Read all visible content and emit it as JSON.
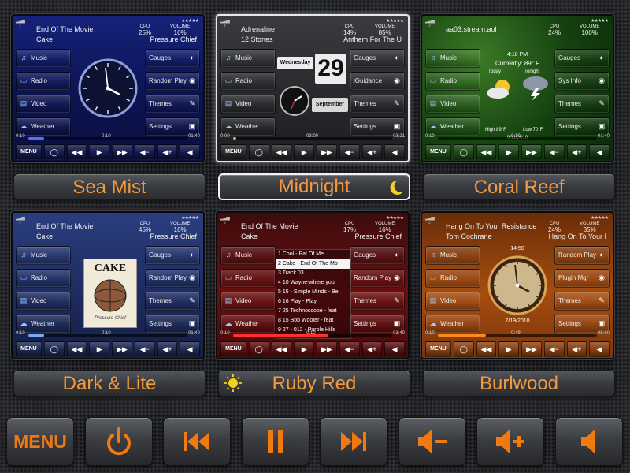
{
  "themes": [
    {
      "name": "Sea Mist",
      "accent": "#5a6dff",
      "line1": "End Of The Movie",
      "line2": "Cake",
      "album": "Pressure Chief",
      "cpu_label": "CPU",
      "cpu": "25%",
      "vol_label": "VOLUME",
      "volume": "16%",
      "left_menu": [
        "Music",
        "Radio",
        "Video",
        "Weather"
      ],
      "right_menu": [
        "Gauges",
        "Random Play",
        "Themes",
        "Settings"
      ],
      "time_start": "0:10",
      "time_mid": "0:10",
      "time_end": "01:40",
      "progress": 0.1,
      "center": "clock"
    },
    {
      "name": "Midnight",
      "accent": "#f0a43a",
      "line1": "Adrenaline",
      "line2": "12 Stones",
      "album": "Anthem For The U",
      "cpu_label": "CPU",
      "cpu": "14%",
      "vol_label": "VOLUME",
      "volume": "85%",
      "left_menu": [
        "Music",
        "Radio",
        "Video",
        "Weather"
      ],
      "right_menu": [
        "Gauges",
        "iGuidance",
        "Themes",
        "Settings"
      ],
      "time_start": "0:00",
      "time_mid": "03:00",
      "time_end": "03:21",
      "progress": 0.02,
      "center": "calendar",
      "weekday": "Wednesday",
      "day": "29",
      "month": "September"
    },
    {
      "name": "Coral Reef",
      "accent": "#45d437",
      "line1": "aa03.stream.aol",
      "line2": "",
      "album": "",
      "cpu_label": "CPU",
      "cpu": "24%",
      "vol_label": "VOLUME",
      "volume": "100%",
      "left_menu": [
        "Music",
        "Radio",
        "Video",
        "Weather"
      ],
      "right_menu": [
        "Gauges",
        "Sys Info",
        "Themes",
        "Settings"
      ],
      "time_start": "0:10",
      "time_mid": "0:10",
      "time_end": "01:40",
      "progress": 0.0,
      "center": "weather",
      "weather_time": "4:18 PM",
      "currently": "Currently: 89° F",
      "today": "Today",
      "tonight": "Tonight",
      "high": "High 89°F",
      "low": "Low 70°F",
      "date": "9/11/2010"
    },
    {
      "name": "Dark & Lite",
      "accent": "#79a8ff",
      "line1": "End Of The Movie",
      "line2": "Cake",
      "album": "Pressure Chief",
      "cpu_label": "CPU",
      "cpu": "45%",
      "vol_label": "VOLUME",
      "volume": "16%",
      "left_menu": [
        "Music",
        "Radio",
        "Video",
        "Weather"
      ],
      "right_menu": [
        "Gauges",
        "Random Play",
        "Themes",
        "Settings"
      ],
      "time_start": "0:10",
      "time_mid": "0:10",
      "time_end": "01:40",
      "progress": 0.1,
      "center": "album",
      "album_title": "CAKE",
      "album_caption": "Pressure Chief"
    },
    {
      "name": "Ruby Red",
      "accent": "#ff3030",
      "line1": "End Of The Movie",
      "line2": "Cake",
      "album": "Pressure Chief",
      "cpu_label": "CPU",
      "cpu": "17%",
      "vol_label": "VOLUME",
      "volume": "16%",
      "left_menu": [
        "Music",
        "Radio",
        "Video",
        "Weather"
      ],
      "right_menu": [
        "Gauges",
        "Random Play",
        "Themes",
        "Settings"
      ],
      "time_start": "0:10",
      "time_mid": "0:10",
      "time_end": "01:40",
      "progress": 0.6,
      "center": "playlist",
      "playlist": [
        "1 Cool - Pat Of Me",
        "2 Cake - End Of The Mo",
        "3 Track 03",
        "4 10 Wayne-where you",
        "5 15 - Simple Minds - Be",
        "6 16 Play - Play",
        "7 25 Technoscope - feat",
        "8 15 Bob Wooter - feat",
        "9 27 - 012 - Purple Hills"
      ]
    },
    {
      "name": "Burlwood",
      "accent": "#ff8a1a",
      "line1": "Hang On To Your Resistance",
      "line2": "Tom Cochrane",
      "album": "Hang On To Your I",
      "cpu_label": "CPU",
      "cpu": "24%",
      "vol_label": "VOLUME",
      "volume": "35%",
      "left_menu": [
        "Music",
        "Radio",
        "Video",
        "Weather"
      ],
      "right_menu": [
        "Random Play",
        "Plugin Mgr",
        "Themes",
        "Settings"
      ],
      "time_start": "0:10",
      "time_mid": "0:49",
      "time_end": "05:00",
      "progress": 0.3,
      "center": "gauge",
      "gauge_time": "14:50",
      "gauge_date": "7/19/2010"
    }
  ],
  "mini_controls": [
    "MENU",
    "power-icon",
    "prev-icon",
    "play-icon",
    "next-icon",
    "vol-down-icon",
    "vol-up-icon",
    "mute-icon"
  ],
  "selected_theme": "Midnight",
  "bottom_bar": {
    "menu_label": "MENU",
    "buttons": [
      "menu",
      "power-icon",
      "previous-icon",
      "pause-icon",
      "next-icon",
      "volume-down-icon",
      "volume-up-icon",
      "mute-icon"
    ],
    "accent": "#f07a12"
  }
}
